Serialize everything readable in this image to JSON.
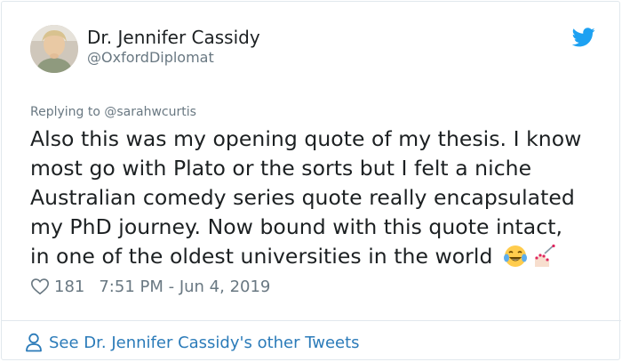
{
  "author": {
    "name": "Dr. Jennifer Cassidy",
    "handle": "@OxfordDiplomat"
  },
  "reply": {
    "prefix": "Replying to ",
    "handle": "@sarahwcurtis"
  },
  "tweet": {
    "lines": [
      "Also this was my opening quote of my thesis. I know",
      "most go with Plato or the sorts but I felt a niche",
      "Australian comedy series quote really encapsulated",
      "my PhD journey. Now bound with this quote intact,",
      "in one of the oldest universities in the world"
    ]
  },
  "meta": {
    "likes": "181",
    "timestamp": "7:51 PM - Jun 4, 2019"
  },
  "footer": {
    "other_tweets": "See Dr. Jennifer Cassidy's other Tweets"
  },
  "colors": {
    "twitter_blue": "#1da1f2",
    "link_blue": "#2b7bb9",
    "secondary_text": "#697882"
  },
  "icons": [
    "avatar",
    "twitter-bird-icon",
    "tears-of-joy-emoji",
    "nail-polish-emoji",
    "heart-icon",
    "user-icon"
  ]
}
